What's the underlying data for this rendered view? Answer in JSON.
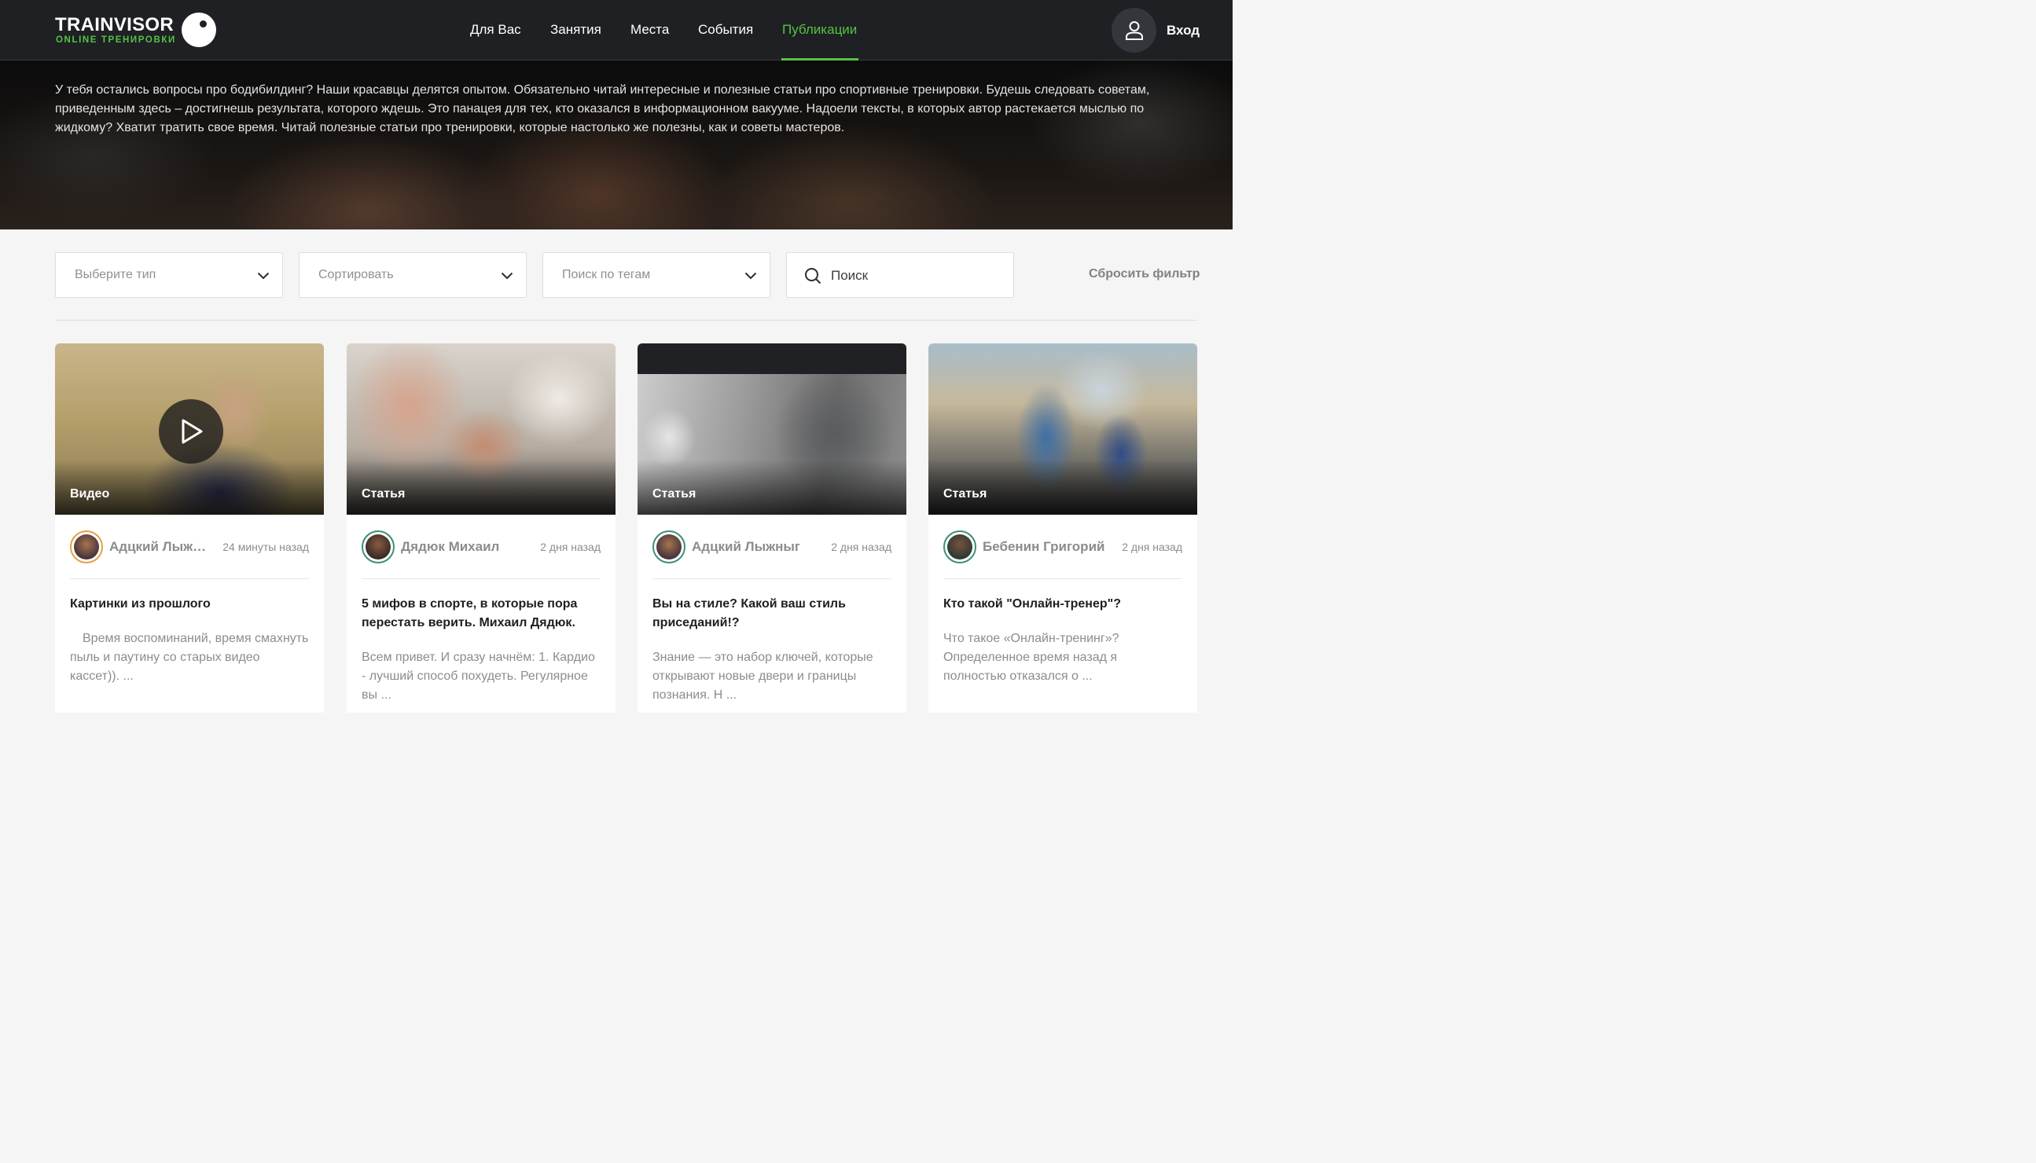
{
  "header": {
    "logo_title": "TRAINVISOR",
    "logo_subtitle": "ONLINE ТРЕНИРОВКИ",
    "nav": [
      {
        "label": "Для Вас"
      },
      {
        "label": "Занятия"
      },
      {
        "label": "Места"
      },
      {
        "label": "События"
      },
      {
        "label": "Публикации",
        "active": true
      }
    ],
    "login_label": "Вход"
  },
  "hero": {
    "text": "У тебя остались вопросы про бодибилдинг? Наши красавцы делятся опытом. Обязательно читай интересные и полезные статьи про спортивные тренировки. Будешь следовать советам, приведенным здесь – достигнешь результата, которого ждешь. Это панацея для тех, кто оказался в информационном вакууме. Надоели тексты, в которых автор растекается мыслью по жидкому? Хватит тратить свое время. Читай полезные статьи про тренировки, которые настолько же полезны, как и советы мастеров."
  },
  "filters": {
    "type_placeholder": "Выберите тип",
    "sort_placeholder": "Сортировать",
    "tags_placeholder": "Поиск по тегам",
    "search_placeholder": "Поиск",
    "reset_label": "Сбросить фильтр"
  },
  "cards": [
    {
      "type": "Видео",
      "author": "Адцкий Лыжныг",
      "time": "24 минуты назад",
      "title": "Картинки из прошлого",
      "excerpt": "Время воспоминаний, время смахнуть пыль и паутину со старых видео кассет)). ..."
    },
    {
      "type": "Статья",
      "author": "Дядюк Михаил",
      "time": "2 дня назад",
      "title": "5 мифов в спорте, в которые пора перестать верить. Михаил Дядюк.",
      "excerpt": "Всем привет. И сразу начнём: 1. Кардио - лучший способ похудеть. Регулярное вы ..."
    },
    {
      "type": "Статья",
      "author": "Адцкий Лыжныг",
      "time": "2 дня назад",
      "title": "Вы на стиле? Какой ваш стиль приседаний!?",
      "excerpt": "Знание — это набор ключей, которые открывают новые двери и границы познания. Н ..."
    },
    {
      "type": "Статья",
      "author": "Бебенин Григорий",
      "time": "2 дня назад",
      "title": "Кто такой \"Онлайн-тренер\"?",
      "excerpt": "Что такое «Онлайн-тренинг»? Определенное время назад я полностью отказался о ..."
    }
  ],
  "colors": {
    "accent": "#57c246",
    "header_bg": "#1e2023",
    "page_bg": "#f4f5f4"
  },
  "icons": [
    "user-icon",
    "chevron-down-icon",
    "search-icon",
    "play-icon"
  ]
}
